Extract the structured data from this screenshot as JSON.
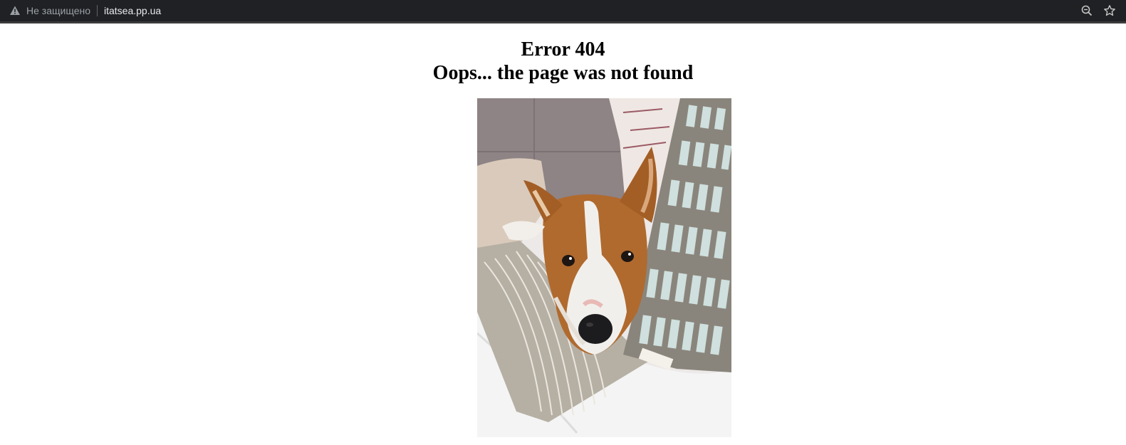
{
  "browser": {
    "security_label": "Не защищено",
    "url": "itatsea.pp.ua",
    "icons": [
      "warning-icon",
      "zoom-icon",
      "bookmark-star-icon"
    ]
  },
  "page": {
    "title_line1": "Error 404",
    "title_line2": "Oops... the page was not found",
    "image": "dog-lying-on-pillows"
  },
  "colors": {
    "toolbar_bg": "#202124",
    "toolbar_text": "#9aa0a6",
    "url_text": "#e8eaed",
    "page_bg": "#ffffff"
  }
}
